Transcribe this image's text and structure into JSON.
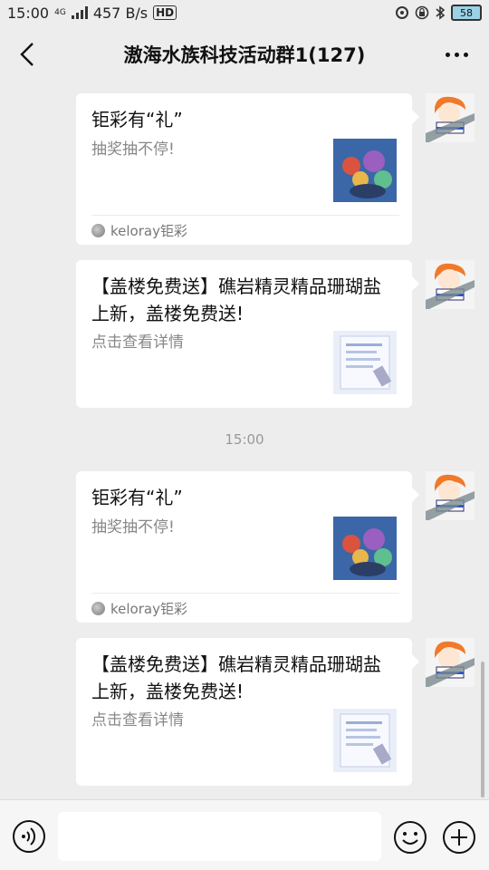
{
  "status_bar": {
    "time": "15:00",
    "network": "4G",
    "speed": "457 B/s",
    "hd": "HD",
    "battery": "58"
  },
  "header": {
    "title": "滶海水族科技活动群1(127)"
  },
  "messages": [
    {
      "card_title": "钜彩有“礼”",
      "card_desc": "抽奖抽不停!",
      "source": "keloray钜彩"
    },
    {
      "card_title": "【盖楼免费送】礁岩精灵精品珊瑚盐上新，盖楼免费送!",
      "card_desc": "点击查看详情"
    },
    {
      "card_title": "钜彩有“礼”",
      "card_desc": "抽奖抽不停!",
      "source": "keloray钜彩"
    },
    {
      "card_title": "【盖楼免费送】礁岩精灵精品珊瑚盐上新，盖楼免费送!",
      "card_desc": "点击查看详情"
    }
  ],
  "timestamp": "15:00",
  "colors": {
    "background": "#ededed",
    "bubble": "#ffffff",
    "secondary_text": "#888888"
  },
  "icons": [
    "back-arrow-icon",
    "more-dots-icon",
    "voice-icon",
    "emoji-icon",
    "plus-icon"
  ]
}
